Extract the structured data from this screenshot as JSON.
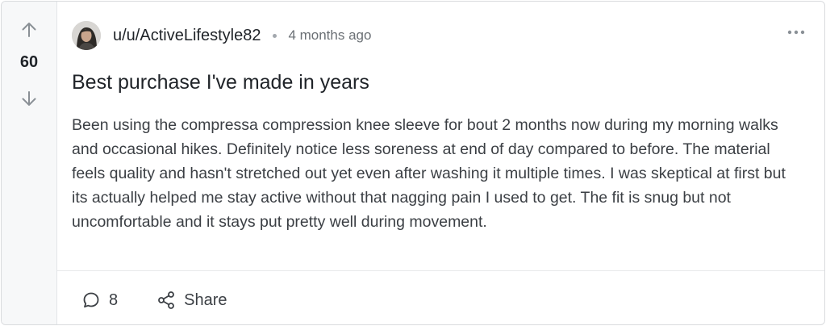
{
  "post": {
    "score": "60",
    "username": "u/u/ActiveLifestyle82",
    "time": "4 months ago",
    "title": "Best purchase I've made in years",
    "body": "Been using the compressa compression knee sleeve for bout 2 months now during my morning walks and occasional hikes. Definitely notice less soreness at end of day compared to before. The material feels quality and hasn't stretched out yet even after washing it multiple times. I was skeptical at first but its actually helped me stay active without that nagging pain I used to get. The fit is snug but not uncomfortable and it stays put pretty well during movement.",
    "comment_count": "8",
    "share_label": "Share"
  },
  "icons": {
    "upvote": "arrow-up-icon",
    "downvote": "arrow-down-icon",
    "more": "more-horizontal-icon",
    "comment": "comment-bubble-icon",
    "share": "share-icon"
  },
  "colors": {
    "vote_column_bg": "#f7f8f9",
    "text_primary": "#1f2328",
    "text_muted": "#6b7075",
    "border": "#d9dbde"
  }
}
